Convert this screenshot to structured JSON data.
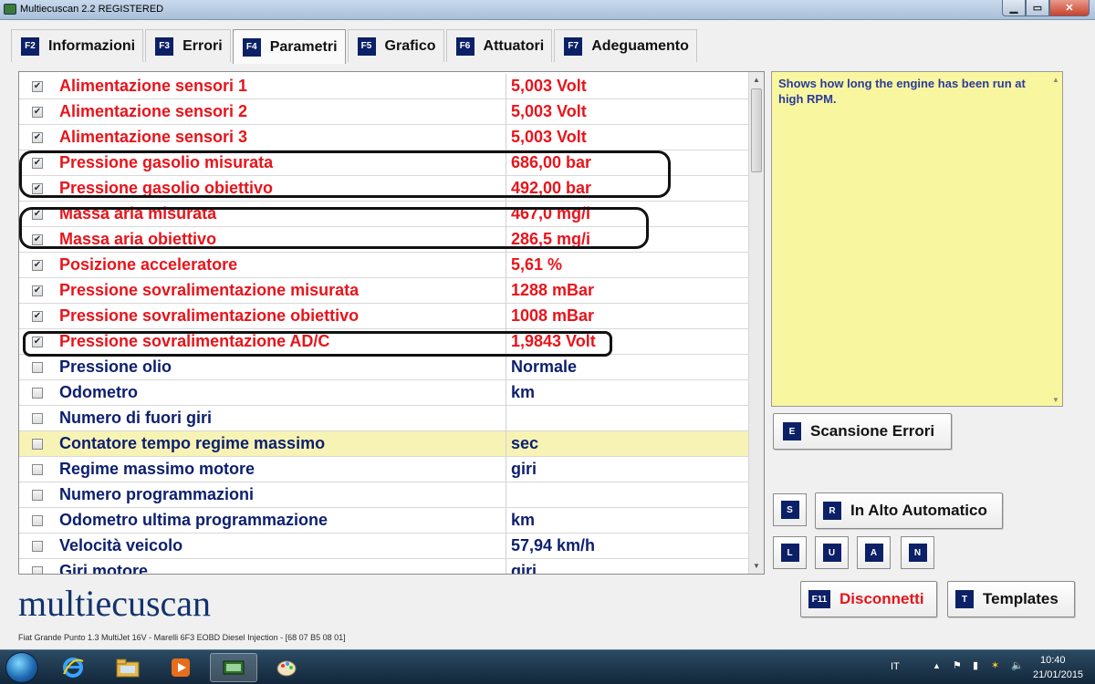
{
  "window": {
    "title": "Multiecuscan 2.2 REGISTERED",
    "min": "▁",
    "max": "▭",
    "close": "✕"
  },
  "tabs": [
    {
      "key": "F2",
      "label": "Informazioni"
    },
    {
      "key": "F3",
      "label": "Errori"
    },
    {
      "key": "F4",
      "label": "Parametri"
    },
    {
      "key": "F5",
      "label": "Grafico"
    },
    {
      "key": "F6",
      "label": "Attuatori"
    },
    {
      "key": "F7",
      "label": "Adeguamento"
    }
  ],
  "active_tab": "Parametri",
  "colors": {
    "active_value": "#e8141b",
    "inactive_value": "#0c1f6e",
    "highlight_row": "#f7f3b5",
    "info_panel": "#f9f6a0"
  },
  "parameters": [
    {
      "name": "Alimentazione sensori 1",
      "value": "5,003 Volt",
      "checked": true
    },
    {
      "name": "Alimentazione sensori 2",
      "value": "5,003 Volt",
      "checked": true
    },
    {
      "name": "Alimentazione sensori 3",
      "value": "5,003 Volt",
      "checked": true
    },
    {
      "name": "Pressione gasolio misurata",
      "value": "686,00 bar",
      "checked": true
    },
    {
      "name": "Pressione gasolio obiettivo",
      "value": "492,00 bar",
      "checked": true
    },
    {
      "name": "Massa aria misurata",
      "value": "467,0 mg/i",
      "checked": true
    },
    {
      "name": "Massa aria obiettivo",
      "value": "286,5 mg/i",
      "checked": true
    },
    {
      "name": "Posizione acceleratore",
      "value": "5,61 %",
      "checked": true
    },
    {
      "name": "Pressione sovralimentazione misurata",
      "value": "1288 mBar",
      "checked": true
    },
    {
      "name": "Pressione sovralimentazione obiettivo",
      "value": "1008 mBar",
      "checked": true
    },
    {
      "name": "Pressione sovralimentazione AD/C",
      "value": "1,9843 Volt",
      "checked": true
    },
    {
      "name": "Pressione olio",
      "value": "Normale",
      "checked": false
    },
    {
      "name": "Odometro",
      "value": " km",
      "checked": false
    },
    {
      "name": "Numero di fuori giri",
      "value": "",
      "checked": false
    },
    {
      "name": "Contatore tempo regime massimo",
      "value": " sec",
      "checked": false,
      "selected": true
    },
    {
      "name": "Regime massimo motore",
      "value": " giri",
      "checked": false
    },
    {
      "name": "Numero programmazioni",
      "value": "",
      "checked": false
    },
    {
      "name": "Odometro ultima programmazione",
      "value": " km",
      "checked": false
    },
    {
      "name": "Velocità veicolo",
      "value": "57,94 km/h",
      "checked": false
    },
    {
      "name": "Giri motore",
      "value": " giri",
      "checked": false
    }
  ],
  "info": {
    "description": "Shows how long the engine has been run at high RPM."
  },
  "buttons": {
    "scan": {
      "key": "E",
      "label": "Scansione Errori"
    },
    "s": {
      "key": "S"
    },
    "auto": {
      "key": "R",
      "label": "In Alto Automatico"
    },
    "l": {
      "key": "L"
    },
    "u": {
      "key": "U"
    },
    "a": {
      "key": "A"
    },
    "n": {
      "key": "N"
    },
    "disconnect": {
      "key": "F11",
      "label": "Disconnetti"
    },
    "templates": {
      "key": "T",
      "label": "Templates"
    }
  },
  "logo": "multiecuscan",
  "status": "Fiat Grande Punto 1.3 MultiJet 16V - Marelli 6F3 EOBD Diesel Injection - [68 07 B5 08 01]",
  "taskbar": {
    "lang": "IT",
    "time": "10:40",
    "date": "21/01/2015",
    "icons": [
      "ie-icon",
      "explorer-icon",
      "media-player-icon",
      "multiecuscan-icon",
      "paint-icon"
    ]
  }
}
